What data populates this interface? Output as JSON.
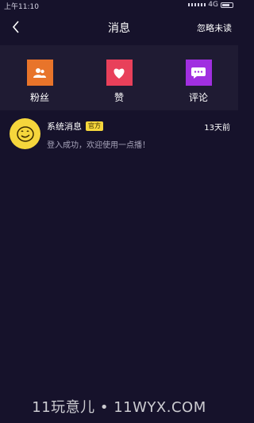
{
  "status_bar": {
    "time": "上午11:10",
    "network": "4G"
  },
  "nav": {
    "title": "消息",
    "action": "忽略未读"
  },
  "categories": [
    {
      "label": "粉丝",
      "icon": "fans-icon",
      "color": "#e8742a"
    },
    {
      "label": "赞",
      "icon": "heart-icon",
      "color": "#e8405a"
    },
    {
      "label": "评论",
      "icon": "comment-icon",
      "color": "#a02fe0"
    }
  ],
  "messages": [
    {
      "title": "系统消息",
      "badge": "官方",
      "time": "13天前",
      "preview": "登入成功，欢迎使用一点播！",
      "avatar_icon": "smiley-icon"
    }
  ],
  "watermark": "11玩意儿 • 11WYX.COM",
  "colors": {
    "background": "#16122b",
    "panel": "#1f1b33",
    "badge": "#f5d63c"
  }
}
